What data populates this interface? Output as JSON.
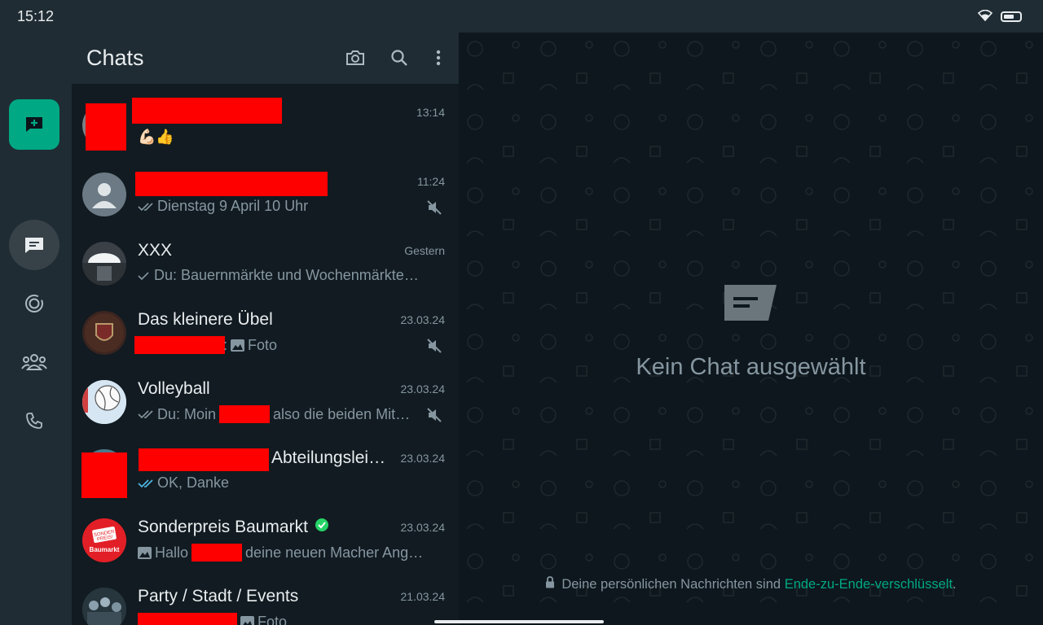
{
  "status_bar": {
    "time": "15:12"
  },
  "chat_list": {
    "title": "Chats",
    "items": [
      {
        "name": "",
        "time": "13:14",
        "preview": "💪🏻👍",
        "tick": "none",
        "muted": false
      },
      {
        "name": "",
        "time": "11:24",
        "preview": "Dienstag 9 April 10 Uhr",
        "tick": "double",
        "muted": true
      },
      {
        "name": "XXX",
        "time": "Gestern",
        "preview": "Du: Bauernmärkte und Wochenmärkte…",
        "tick": "single",
        "muted": false
      },
      {
        "name": "Das kleinere Übel",
        "time": "23.03.24",
        "preview": "Foto",
        "prefix": ":",
        "tick": "none",
        "muted": true
      },
      {
        "name": "Volleyball",
        "time": "23.03.24",
        "preview_a": "Du: Moin",
        "preview_b": "also die beiden Mit…",
        "tick": "double",
        "muted": true
      },
      {
        "name": "Abteilungslei…",
        "time": "23.03.24",
        "preview": "OK, Danke",
        "tick": "double-blue",
        "muted": false
      },
      {
        "name": "Sonderpreis Baumarkt",
        "time": "23.03.24",
        "preview_a": "Hallo",
        "preview_b": "deine neuen Macher Ang…",
        "tick": "none",
        "muted": false,
        "verified": true,
        "avatar_text_top": "SONDER PREIS!",
        "avatar_text_bottom": "Baumarkt"
      },
      {
        "name": "Party / Stadt / Events",
        "time": "21.03.24",
        "preview": "Foto",
        "tick": "none",
        "muted": true
      }
    ]
  },
  "conversation": {
    "empty_title": "Kein Chat ausgewählt",
    "e2e_text": "Deine persönlichen Nachrichten sind",
    "e2e_link": "Ende-zu-Ende-verschlüsselt",
    "e2e_end": "."
  },
  "colors": {
    "accent": "#00a884",
    "panel": "#111b21",
    "header": "#1f2c33",
    "redaction": "#ff0000"
  }
}
